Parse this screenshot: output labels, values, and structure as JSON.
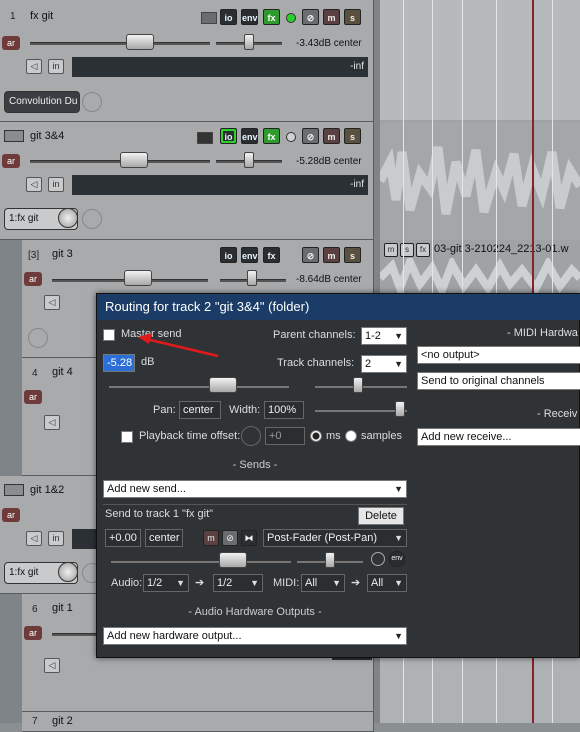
{
  "tracks": [
    {
      "number": "1",
      "name": "fx git",
      "volume": "-3.43dB center",
      "meter": "-inf",
      "fx_slot": "Convolution Du"
    },
    {
      "number": "",
      "name": "git 3&4",
      "volume": "-5.28dB center",
      "meter": "-inf",
      "fx_slot": "1:fx git"
    },
    {
      "number": "[3]",
      "name": "git 3",
      "volume": "-8.64dB center"
    },
    {
      "number": "4",
      "name": "git 4"
    },
    {
      "number": "",
      "name": "git 1&2",
      "fx_slot": "1:fx git"
    },
    {
      "number": "6",
      "name": "git 1"
    },
    {
      "number": "7",
      "name": "git 2"
    }
  ],
  "track_buttons": {
    "io": "io",
    "env": "env",
    "fx": "fx",
    "mute": "m",
    "solo": "s",
    "arm": "ar",
    "input": "in"
  },
  "item": {
    "label": "03-git 3-210224_2213-01.w",
    "btn_m": "m",
    "btn_s": "s",
    "btn_fx": "fx"
  },
  "dialog": {
    "title": "Routing for track 2 \"git 3&4\" (folder)",
    "master_send_label": "Master send",
    "master_send_checked": false,
    "parent_channels_label": "Parent channels:",
    "parent_channels_value": "1-2",
    "track_channels_label": "Track channels:",
    "track_channels_value": "2",
    "volume_value": "-5.28",
    "volume_unit": "dB",
    "pan_label": "Pan:",
    "pan_value": "center",
    "width_label": "Width:",
    "width_value": "100%",
    "playback_offset_label": "Playback time offset:",
    "playback_offset_value": "+0",
    "ms_label": "ms",
    "samples_label": "samples",
    "offset_unit_selected": "ms",
    "sends_header": "- Sends -",
    "add_send_placeholder": "Add new send...",
    "send_title": "Send to track 1 \"fx git\"",
    "delete_label": "Delete",
    "send_volume": "+0.00",
    "send_pan": "center",
    "send_mode": "Post-Fader (Post-Pan)",
    "audio_label": "Audio:",
    "audio_src": "1/2",
    "audio_dst": "1/2",
    "midi_label": "MIDI:",
    "midi_src": "All",
    "midi_dst": "All",
    "arrow_glyph": "➔",
    "hw_header": "- Audio Hardware Outputs -",
    "add_hw_placeholder": "Add new hardware output...",
    "midi_hw_header": "- MIDI Hardwa",
    "midi_hw_output": "<no output>",
    "midi_hw_send": "Send to original channels",
    "receives_header": "- Receiv",
    "add_receive_placeholder": "Add new receive...",
    "send_btn_m": "m",
    "send_btn_env": "env"
  },
  "colors": {
    "title_bar": "#1b3c66",
    "dialog_bg": "#2f3336",
    "annotation_arrow": "#e01a1a",
    "fx_active": "#2f9b2f",
    "record_active": "#2bd12b"
  }
}
